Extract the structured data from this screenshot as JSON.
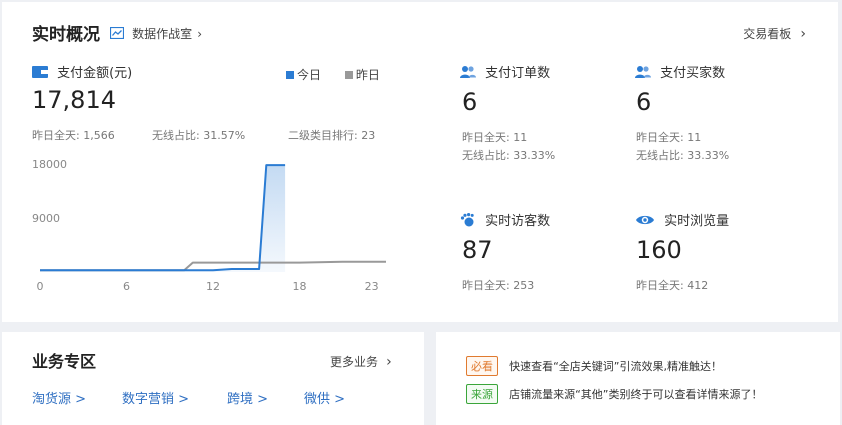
{
  "overview": {
    "title": "实时概况",
    "war_room_label": "数据作战室",
    "trade_board_label": "交易看板"
  },
  "payment": {
    "label": "支付金额(元)",
    "value": "17,814",
    "legend_today": "今日",
    "legend_yesterday": "昨日",
    "yesterday_total": "昨日全天: 1,566",
    "wireless_ratio": "无线占比: 31.57%",
    "category_rank": "二级类目排行: 23"
  },
  "orders": {
    "label": "支付订单数",
    "value": "6",
    "yesterday_total": "昨日全天: 11",
    "wireless_ratio": "无线占比: 33.33%"
  },
  "buyers": {
    "label": "支付买家数",
    "value": "6",
    "yesterday_total": "昨日全天: 11",
    "wireless_ratio": "无线占比: 33.33%"
  },
  "visitors": {
    "label": "实时访客数",
    "value": "87",
    "yesterday_total": "昨日全天: 253"
  },
  "pageviews": {
    "label": "实时浏览量",
    "value": "160",
    "yesterday_total": "昨日全天: 412"
  },
  "chart_data": {
    "type": "line",
    "x_ticks": [
      "0",
      "6",
      "12",
      "18",
      "23"
    ],
    "y_ticks": [
      "18000",
      "9000"
    ],
    "xlim": [
      0,
      24
    ],
    "ylim": [
      0,
      20000
    ],
    "series": [
      {
        "name": "今日",
        "color": "#2b7cd3",
        "x": [
          0,
          6,
          12,
          13.3,
          15.2,
          15.7,
          16.0,
          17.0
        ],
        "y": [
          300,
          300,
          300,
          500,
          500,
          17814,
          17814,
          17814
        ]
      },
      {
        "name": "昨日",
        "color": "#999999",
        "x": [
          0,
          6,
          10.0,
          10.6,
          15,
          18,
          21,
          24
        ],
        "y": [
          300,
          300,
          300,
          1566,
          1566,
          1566,
          1700,
          1700
        ]
      }
    ]
  },
  "business": {
    "title": "业务专区",
    "more_label": "更多业务",
    "links": [
      "淘货源 >",
      "数字营销 >",
      "跨境 >",
      "微供 >"
    ]
  },
  "notices": [
    {
      "tag": "必看",
      "text": "快速查看“全店关键词”引流效果,精准触达！"
    },
    {
      "tag": "来源",
      "text": "店铺流量来源“其他”类别终于可以查看详情来源了！"
    }
  ],
  "colors": {
    "accent": "#2b7cd3",
    "yesterday": "#999999",
    "tag_orange": "#e07a2f",
    "tag_green": "#3aa53a"
  }
}
